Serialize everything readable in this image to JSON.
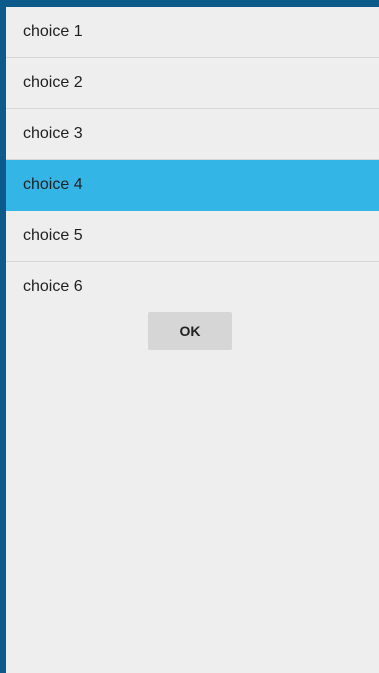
{
  "colors": {
    "background": "#0b5a8a",
    "dialog": "#eeeeee",
    "selected": "#33b5e5",
    "divider": "#d6d6d6",
    "button": "#d6d6d6"
  },
  "choices": [
    {
      "label": "choice 1",
      "selected": false
    },
    {
      "label": "choice 2",
      "selected": false
    },
    {
      "label": "choice 3",
      "selected": false
    },
    {
      "label": "choice 4",
      "selected": true
    },
    {
      "label": "choice 5",
      "selected": false
    },
    {
      "label": "choice 6",
      "selected": false
    }
  ],
  "ok_label": "OK"
}
